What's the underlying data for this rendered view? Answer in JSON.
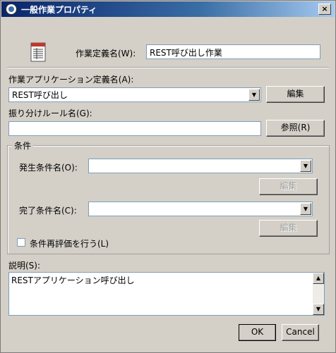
{
  "window": {
    "title": "一般作業プロパティ",
    "close_glyph": "×"
  },
  "definition": {
    "label": "作業定義名(W):",
    "value": "REST呼び出し作業",
    "icon": "document-list-icon"
  },
  "app_definition": {
    "label": "作業アプリケーション定義名(A):",
    "selected": "REST呼び出し",
    "edit_button": "編集"
  },
  "routing_rule": {
    "label": "振り分けルール名(G):",
    "value": "",
    "browse_button": "参照(R)"
  },
  "conditions": {
    "group_label": "条件",
    "start_label": "発生条件名(O):",
    "start_value": "",
    "start_edit": "編集",
    "end_label": "完了条件名(C):",
    "end_value": "",
    "end_edit": "編集",
    "reeval_label": "条件再評価を行う(L)"
  },
  "description": {
    "label": "説明(S):",
    "value": "RESTアプリケーション呼び出し"
  },
  "footer": {
    "ok": "OK",
    "cancel": "Cancel"
  }
}
